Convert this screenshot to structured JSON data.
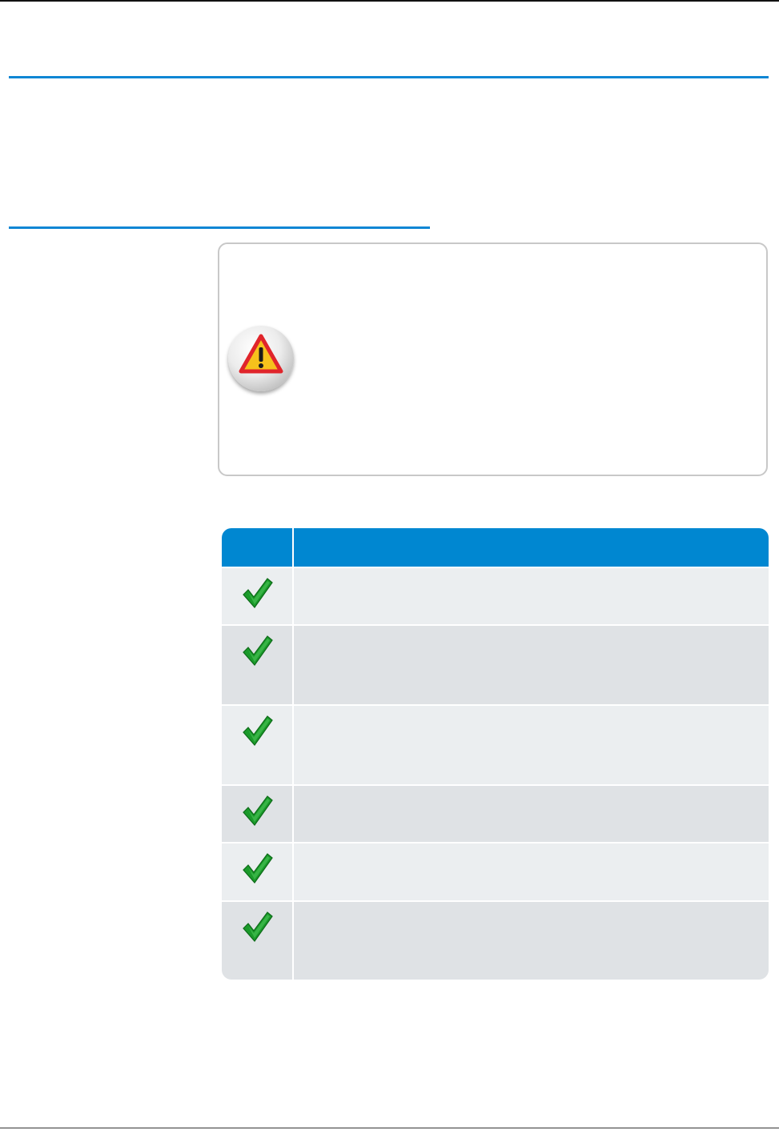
{
  "colors": {
    "accent_blue": "#0e86d4",
    "table_header_blue": "#0087d1",
    "row_light": "#ebeef0",
    "row_dark": "#dfe2e5",
    "check_green": "#1a9a2a",
    "warning_yellow": "#f6c21c",
    "warning_red": "#e0252b"
  },
  "warning": {
    "icon": "warning-triangle-icon",
    "text": ""
  },
  "checklist": {
    "header": {
      "icon_column": "",
      "text_column": ""
    },
    "rows": [
      {
        "icon": "checkmark-icon",
        "text": ""
      },
      {
        "icon": "checkmark-icon",
        "text": ""
      },
      {
        "icon": "checkmark-icon",
        "text": ""
      },
      {
        "icon": "checkmark-icon",
        "text": ""
      },
      {
        "icon": "checkmark-icon",
        "text": ""
      },
      {
        "icon": "checkmark-icon",
        "text": ""
      }
    ]
  }
}
